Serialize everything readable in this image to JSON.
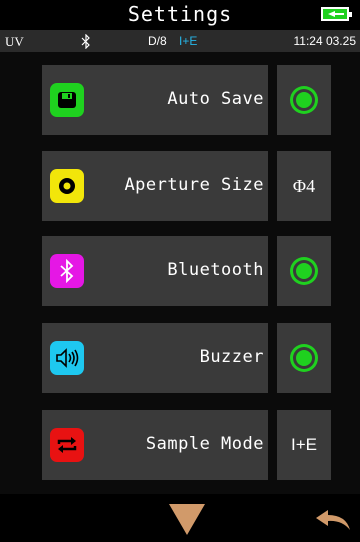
{
  "header": {
    "title": "Settings",
    "battery": "charging-battery-icon"
  },
  "status": {
    "left": "UV",
    "bluetooth_icon": "bluetooth-icon",
    "geometry": "D/8",
    "mode": "I+E",
    "time": "11:24 03.25"
  },
  "settings": [
    {
      "label": "Auto Save",
      "icon": "save-icon",
      "icon_color": "#1fd11f",
      "value_type": "toggle",
      "value": "on"
    },
    {
      "label": "Aperture Size",
      "icon": "aperture-icon",
      "icon_color": "#f2e60a",
      "value_type": "text",
      "value": "Φ4"
    },
    {
      "label": "Bluetooth",
      "icon": "bluetooth-icon",
      "icon_color": "#e517e5",
      "value_type": "toggle",
      "value": "on"
    },
    {
      "label": "Buzzer",
      "icon": "speaker-icon",
      "icon_color": "#1ec8f0",
      "value_type": "toggle",
      "value": "on"
    },
    {
      "label": "Sample Mode",
      "icon": "sample-mode-icon",
      "icon_color": "#e81212",
      "value_type": "text",
      "value": "I+E"
    }
  ],
  "footer": {
    "down_icon": "down-triangle-icon",
    "back_icon": "back-arrow-icon"
  },
  "colors": {
    "accent_green": "#1fd11f",
    "status_blue": "#27b6e8",
    "panel": "#3a3a3a"
  }
}
